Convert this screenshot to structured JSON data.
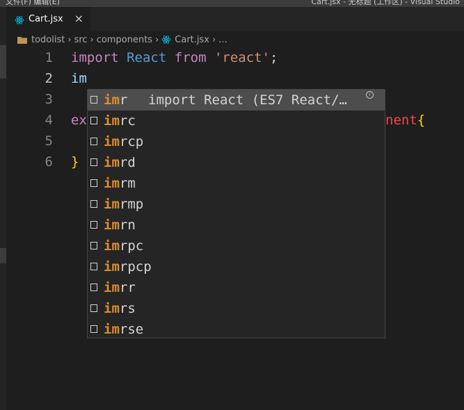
{
  "window": {
    "menu_text": "文件(F)  编辑(E)",
    "title_text": "Cart.jsx - 无标题 (工作区) - Visual Studio"
  },
  "tab": {
    "label": "Cart.jsx",
    "close_glyph": "×",
    "icon": "react-icon"
  },
  "breadcrumb": {
    "items": [
      "todolist",
      "src",
      "components",
      "Cart.jsx",
      "..."
    ],
    "separator": "›"
  },
  "editor": {
    "line_numbers": [
      "1",
      "2",
      "3",
      "4",
      "5",
      "6"
    ],
    "line1": {
      "kw_import": "import",
      "name_react": "React",
      "kw_from": "from",
      "module": "'react'",
      "semicolon": ";"
    },
    "line2": {
      "typed": "im"
    },
    "line4": {
      "visible_start": "ex",
      "visible_end_ident": "nent",
      "brace": "{"
    },
    "line6": {
      "brace": "}"
    }
  },
  "suggest": {
    "match": "im",
    "detail": "import React (ES7 React/…",
    "info_glyph": "i",
    "items": [
      {
        "rest": "r"
      },
      {
        "rest": "rc"
      },
      {
        "rest": "rcp"
      },
      {
        "rest": "rd"
      },
      {
        "rest": "rm"
      },
      {
        "rest": "rmp"
      },
      {
        "rest": "rn"
      },
      {
        "rest": "rpc"
      },
      {
        "rest": "rpcp"
      },
      {
        "rest": "rr"
      },
      {
        "rest": "rs"
      },
      {
        "rest": "rse"
      }
    ]
  },
  "colors": {
    "background": "#1e1e1e",
    "keyword": "#c586c0",
    "variable": "#569cd6",
    "string": "#ce9178",
    "match": "#e08e2c",
    "selected_row": "#4d4d4e"
  }
}
